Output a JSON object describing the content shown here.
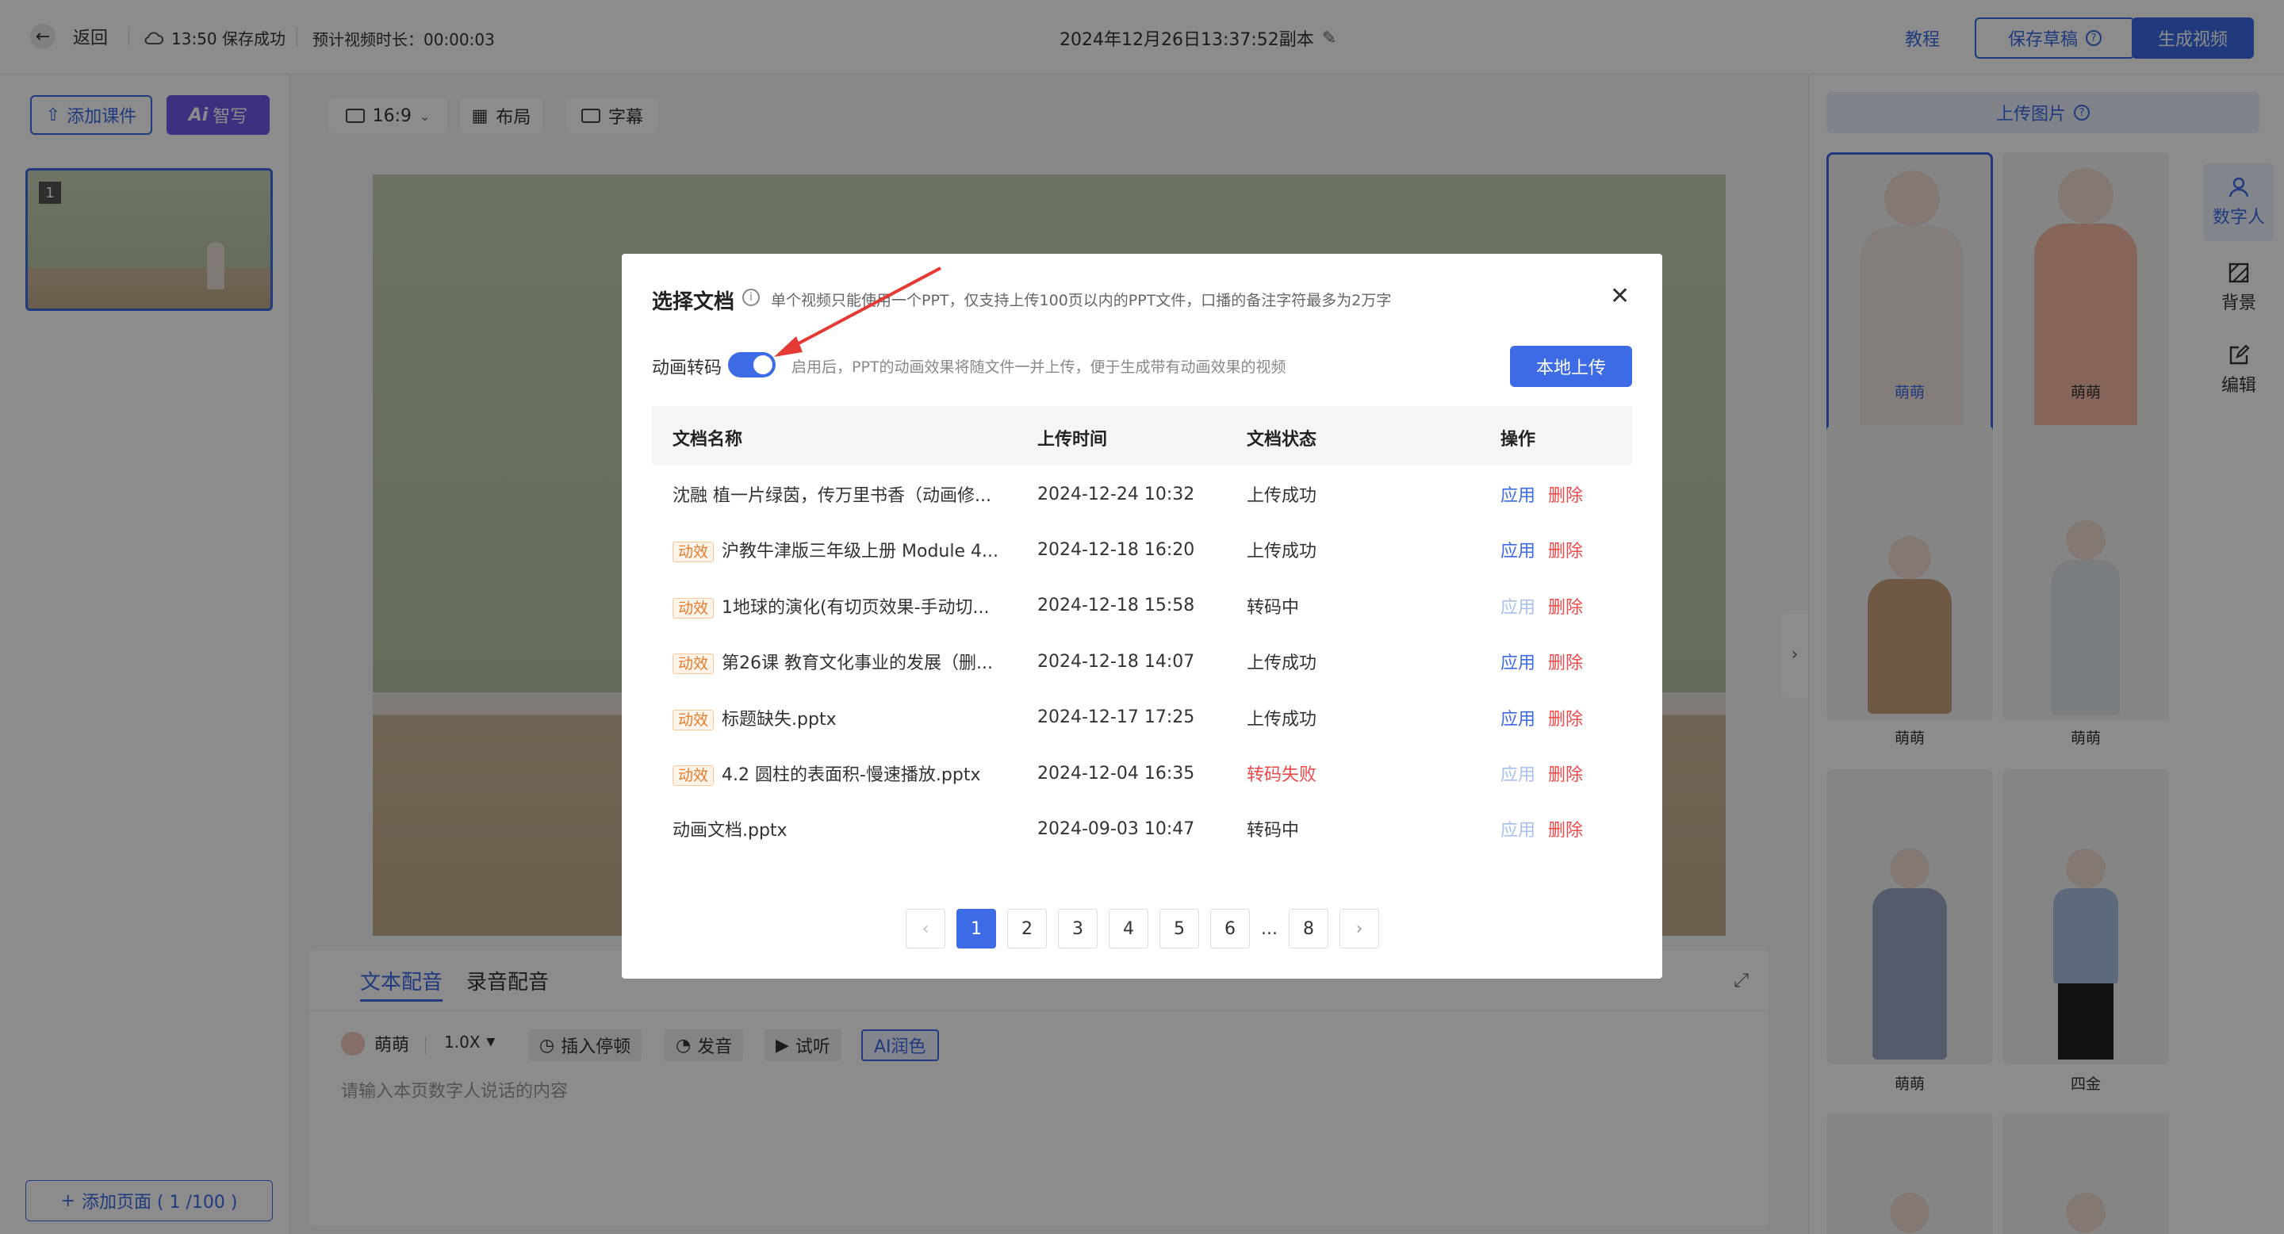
{
  "topbar": {
    "back_label": "返回",
    "save_status": "13:50 保存成功",
    "duration": "预计视频时长：00:00:03",
    "title": "2024年12月26日13:37:52副本",
    "tutorial_label": "教程",
    "save_draft_label": "保存草稿",
    "generate_label": "生成视频"
  },
  "left": {
    "add_courseware_label": "添加课件",
    "ai_write_label": "智写",
    "ai_badge": "Ai",
    "slide_number": "1",
    "add_page_label": "添加页面 ( 1 /100 )"
  },
  "toolbar": {
    "ratio": "16:9",
    "layout_label": "布局",
    "subtitle_label": "字幕"
  },
  "editor": {
    "tabs": [
      "文本配音",
      "录音配音"
    ],
    "voice_name": "萌萌",
    "speed": "1.0X",
    "insert_pause_label": "插入停顿",
    "pronunciation_label": "发音",
    "preview_label": "试听",
    "ai_polish_label": "AI润色",
    "placeholder": "请输入本页数字人说话的内容"
  },
  "right": {
    "upload_image_label": "上传图片",
    "side_items": [
      "数字人",
      "背景",
      "编辑"
    ],
    "avatars": [
      "萌萌",
      "萌萌",
      "萌萌",
      "萌萌",
      "萌萌",
      "四金"
    ]
  },
  "modal": {
    "title": "选择文档",
    "notice": "单个视频只能使用一个PPT，仅支持上传100页以内的PPT文件，口播的备注字符最多为2万字",
    "toggle_label": "动画转码",
    "toggle_on": true,
    "toggle_hint": "启用后，PPT的动画效果将随文件一并上传，便于生成带有动画效果的视频",
    "upload_label": "本地上传",
    "columns": [
      "文档名称",
      "上传时间",
      "文档状态",
      "操作"
    ],
    "apply_label": "应用",
    "delete_label": "删除",
    "tag_label": "动效",
    "rows": [
      {
        "tag": false,
        "name": "沈融 植一片绿茵，传万里书香（动画修...",
        "time": "2024-12-24 10:32",
        "status": "上传成功",
        "status_color": "#333333",
        "apply_enabled": true
      },
      {
        "tag": true,
        "name": "沪教牛津版三年级上册 Module 4...",
        "time": "2024-12-18 16:20",
        "status": "上传成功",
        "status_color": "#333333",
        "apply_enabled": true
      },
      {
        "tag": true,
        "name": "1地球的演化(有切页效果-手动切...",
        "time": "2024-12-18 15:58",
        "status": "转码中",
        "status_color": "#333333",
        "apply_enabled": false
      },
      {
        "tag": true,
        "name": "第26课 教育文化事业的发展（删...",
        "time": "2024-12-18 14:07",
        "status": "上传成功",
        "status_color": "#333333",
        "apply_enabled": true
      },
      {
        "tag": true,
        "name": "标题缺失.pptx",
        "time": "2024-12-17 17:25",
        "status": "上传成功",
        "status_color": "#333333",
        "apply_enabled": true
      },
      {
        "tag": true,
        "name": "4.2 圆柱的表面积-慢速播放.pptx",
        "time": "2024-12-04 16:35",
        "status": "转码失败",
        "status_color": "#ef4848",
        "apply_enabled": false
      },
      {
        "tag": false,
        "name": "动画文档.pptx",
        "time": "2024-09-03 10:47",
        "status": "转码中",
        "status_color": "#333333",
        "apply_enabled": false
      }
    ],
    "pagination": {
      "pages": [
        "1",
        "2",
        "3",
        "4",
        "5",
        "6",
        "...",
        "8"
      ],
      "current": "1"
    }
  },
  "colors": {
    "accent": "#3d6be6",
    "danger": "#ef4848",
    "tag": "#e87b2b",
    "annotation": "#e53935"
  }
}
